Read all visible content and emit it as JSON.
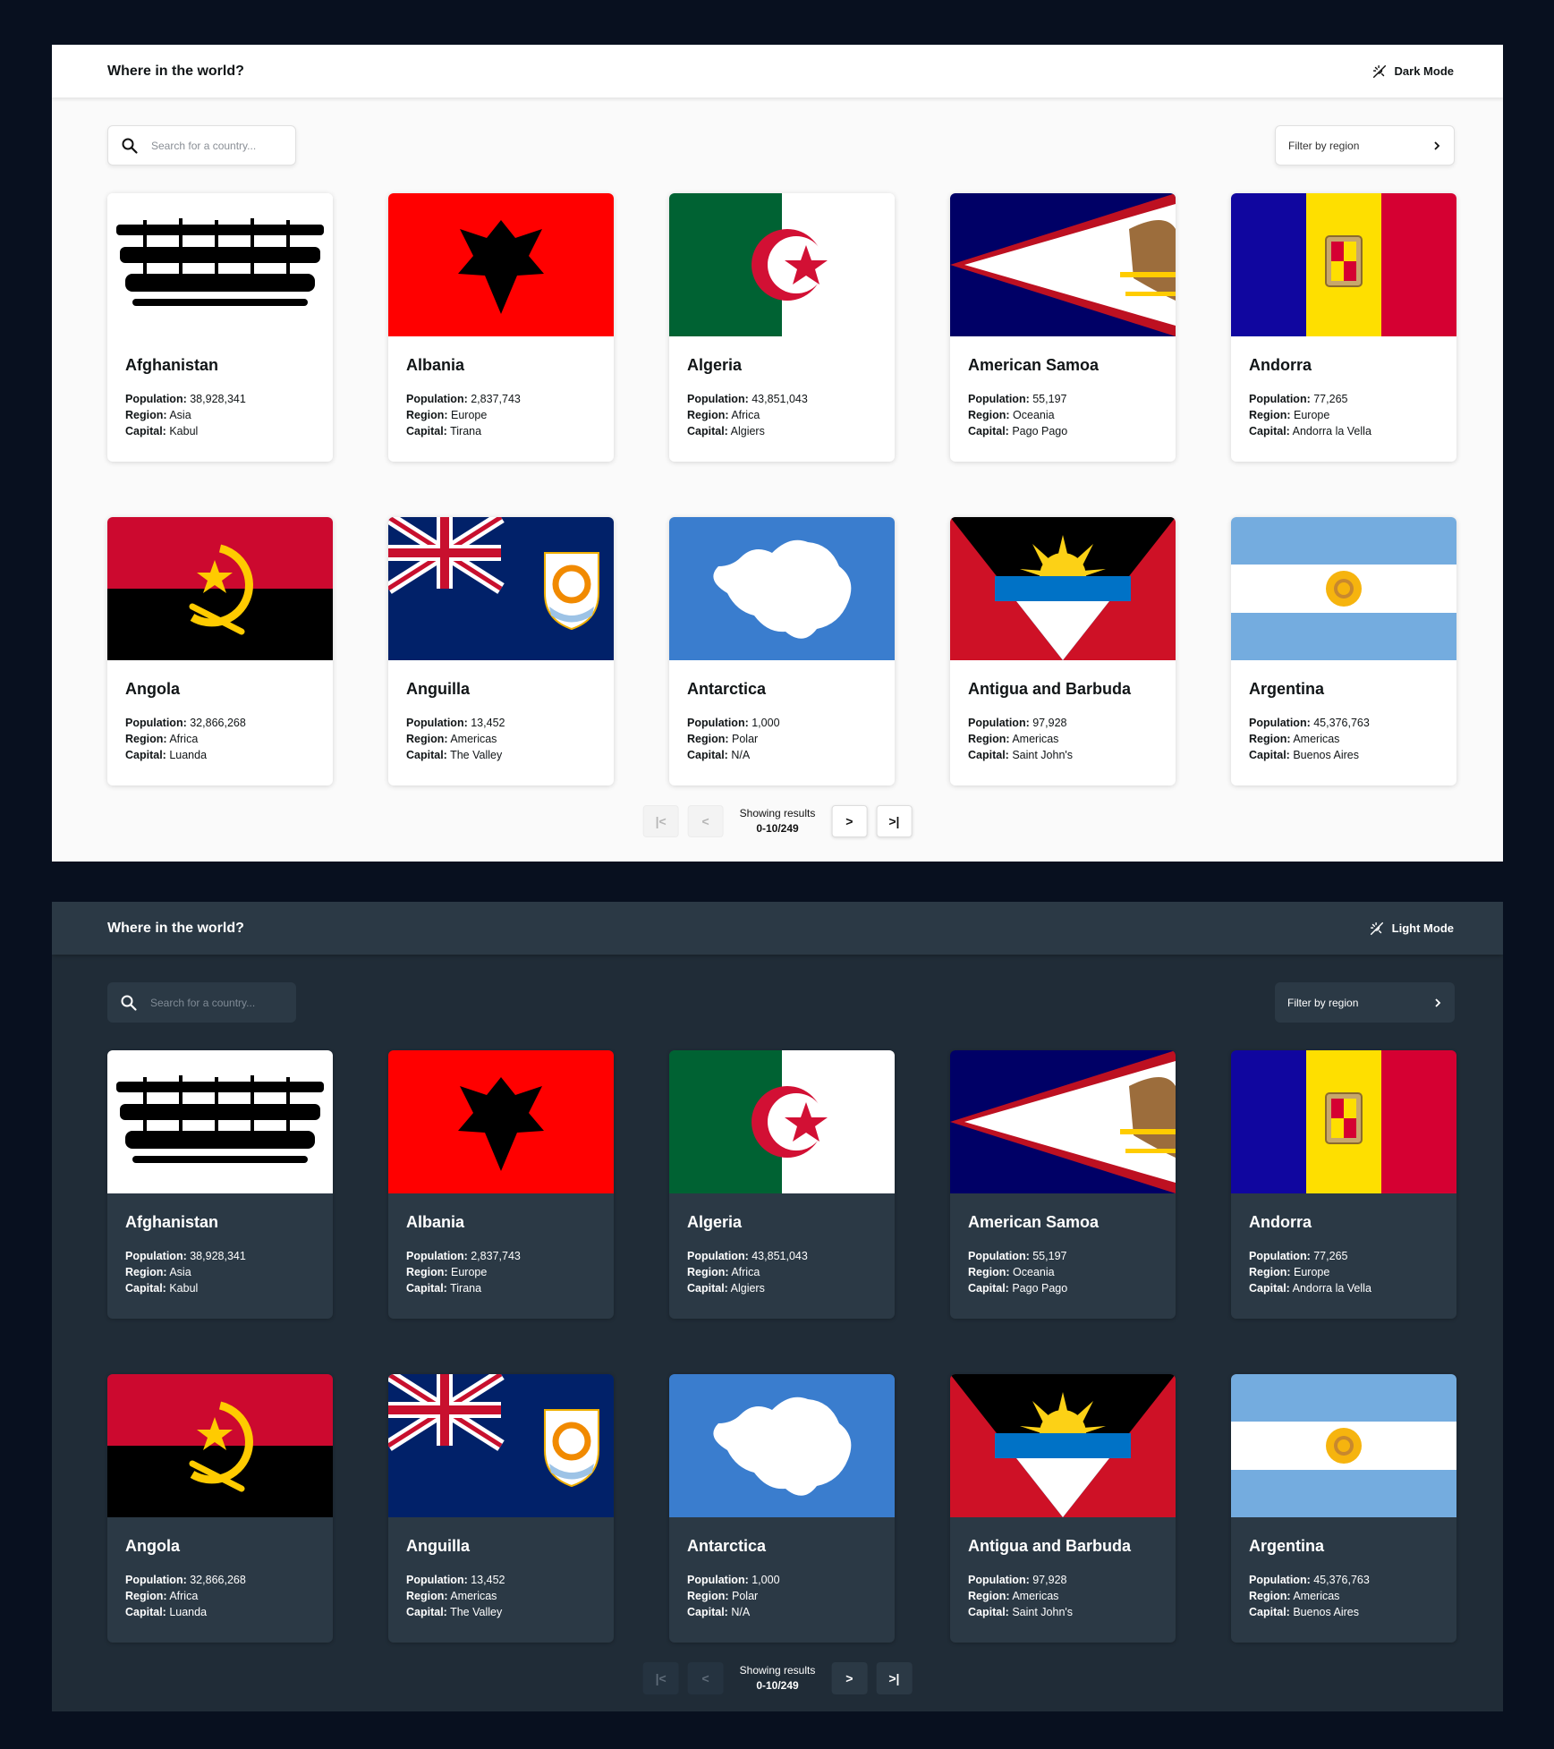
{
  "brand": "Where in the world?",
  "themes": {
    "light": {
      "mode_label": "Dark Mode"
    },
    "dark": {
      "mode_label": "Light Mode"
    }
  },
  "search": {
    "placeholder": "Search for a country..."
  },
  "filter": {
    "label": "Filter by region"
  },
  "labels": {
    "population": "Population:",
    "region": "Region:",
    "capital": "Capital:"
  },
  "countries": [
    {
      "name": "Afghanistan",
      "population": "38,928,341",
      "region": "Asia",
      "capital": "Kabul",
      "flag": "afghanistan-flag"
    },
    {
      "name": "Albania",
      "population": "2,837,743",
      "region": "Europe",
      "capital": "Tirana",
      "flag": "albania-flag"
    },
    {
      "name": "Algeria",
      "population": "43,851,043",
      "region": "Africa",
      "capital": "Algiers",
      "flag": "algeria-flag"
    },
    {
      "name": "American Samoa",
      "population": "55,197",
      "region": "Oceania",
      "capital": "Pago Pago",
      "flag": "american-samoa-flag"
    },
    {
      "name": "Andorra",
      "population": "77,265",
      "region": "Europe",
      "capital": "Andorra la Vella",
      "flag": "andorra-flag"
    },
    {
      "name": "Angola",
      "population": "32,866,268",
      "region": "Africa",
      "capital": "Luanda",
      "flag": "angola-flag"
    },
    {
      "name": "Anguilla",
      "population": "13,452",
      "region": "Americas",
      "capital": "The Valley",
      "flag": "anguilla-flag"
    },
    {
      "name": "Antarctica",
      "population": "1,000",
      "region": "Polar",
      "capital": "N/A",
      "flag": "antarctica-flag"
    },
    {
      "name": "Antigua and Barbuda",
      "population": "97,928",
      "region": "Americas",
      "capital": "Saint John's",
      "flag": "antigua-flag"
    },
    {
      "name": "Argentina",
      "population": "45,376,763",
      "region": "Americas",
      "capital": "Buenos Aires",
      "flag": "argentina-flag"
    }
  ],
  "pagination": {
    "first": "|<",
    "prev": "<",
    "next": ">",
    "last": ">|",
    "showing_label": "Showing results",
    "range": "0-10/249"
  },
  "colors": {
    "light_bg": "#fafafa",
    "light_card": "#ffffff",
    "dark_bg": "#202c37",
    "dark_card": "#2b3945",
    "page_bg": "#08101f"
  }
}
